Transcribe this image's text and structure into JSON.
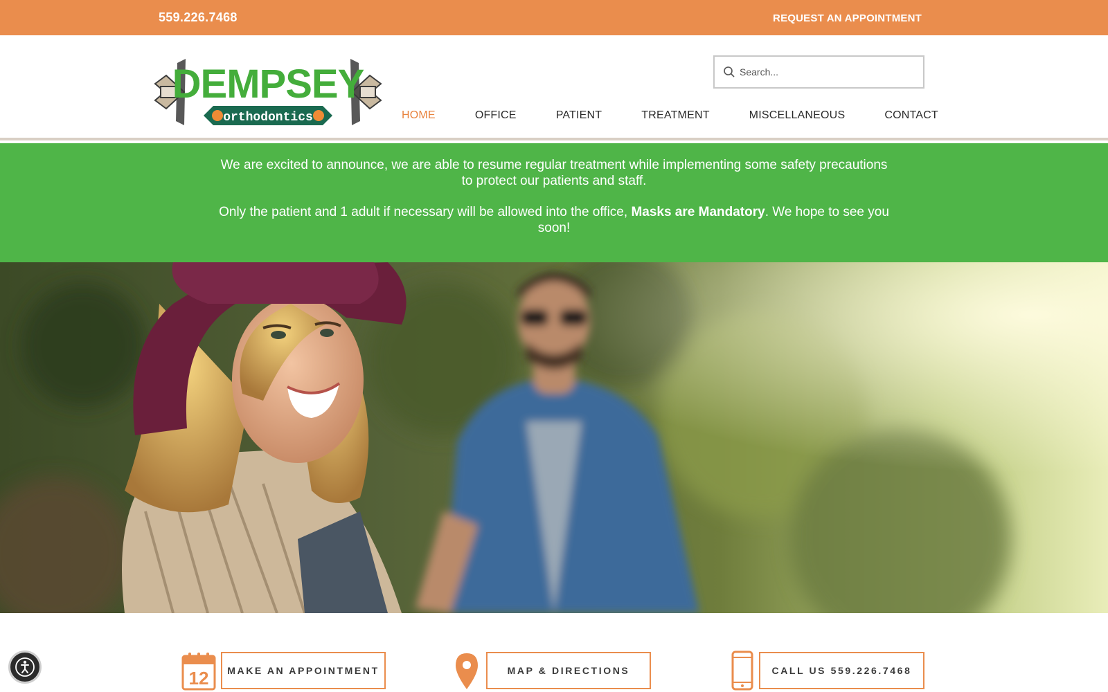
{
  "topbar": {
    "phone": "559.226.7468",
    "request_label": "REQUEST AN APPOINTMENT",
    "color": "#ea8d4d"
  },
  "logo": {
    "name": "DEMPSEY",
    "tagline": "orthodontics"
  },
  "search": {
    "placeholder": "Search...",
    "icon": "search-icon"
  },
  "nav": {
    "items": [
      {
        "label": "HOME",
        "active": true
      },
      {
        "label": "OFFICE"
      },
      {
        "label": "PATIENT"
      },
      {
        "label": "TREATMENT"
      },
      {
        "label": "MISCELLANEOUS"
      },
      {
        "label": "CONTACT"
      }
    ],
    "active_color": "#e8833e"
  },
  "banner": {
    "line1": "We are excited to announce, we are able to resume regular treatment while implementing some safety precautions to protect our patients and staff.",
    "line2_pre": "Only the patient and 1 adult if necessary will be allowed into the office, ",
    "line2_bold": "Masks are Mandatory",
    "line2_post": ". We hope to see you soon!",
    "color": "#4fb548"
  },
  "actions": [
    {
      "icon": "calendar-icon",
      "icon_text": "12",
      "label": "MAKE AN APPOINTMENT"
    },
    {
      "icon": "map-pin-icon",
      "label": "MAP & DIRECTIONS"
    },
    {
      "icon": "phone-icon",
      "label": "CALL US 559.226.7468"
    }
  ],
  "accessibility": {
    "icon": "accessibility-icon"
  }
}
